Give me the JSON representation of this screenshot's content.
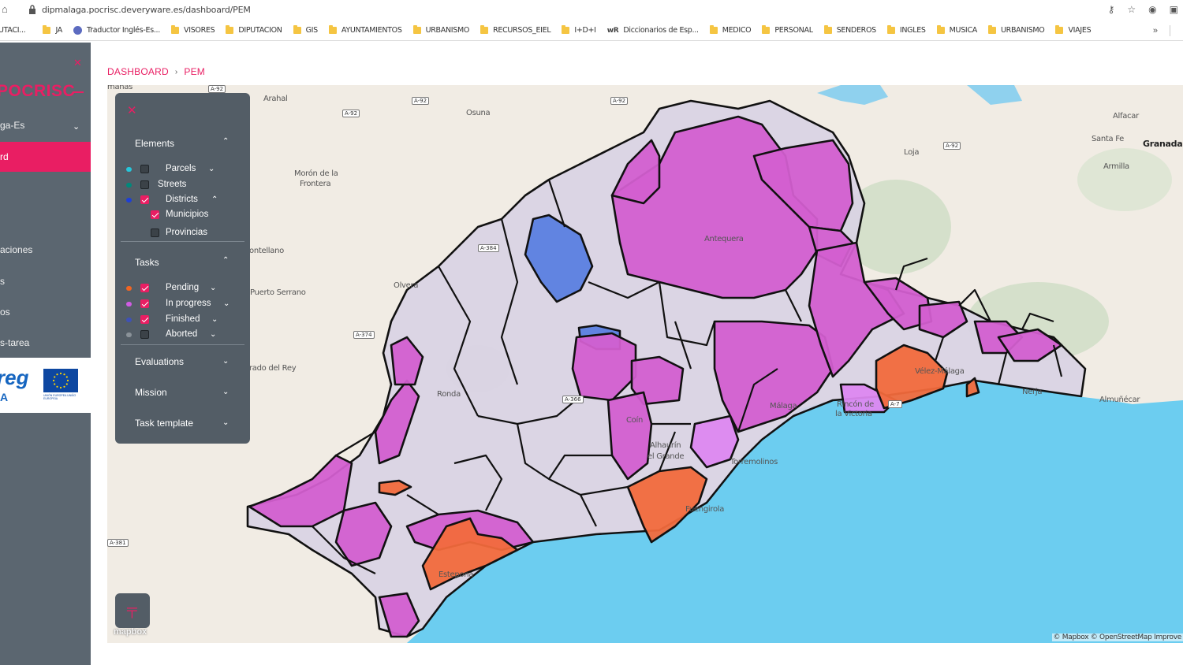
{
  "browser": {
    "url": "dipmalaga.pocrisc.deveryware.es/dashboard/PEM",
    "bookmarks": [
      {
        "label": "UTACI...",
        "icon": "none"
      },
      {
        "label": "JA",
        "icon": "folder"
      },
      {
        "label": "Traductor Inglés-Es...",
        "icon": "globe"
      },
      {
        "label": "VISORES",
        "icon": "folder"
      },
      {
        "label": "DIPUTACION",
        "icon": "folder"
      },
      {
        "label": "GIS",
        "icon": "folder"
      },
      {
        "label": "AYUNTAMIENTOS",
        "icon": "folder"
      },
      {
        "label": "URBANISMO",
        "icon": "folder"
      },
      {
        "label": "RECURSOS_EIEL",
        "icon": "folder"
      },
      {
        "label": "I+D+I",
        "icon": "folder"
      },
      {
        "label": "Diccionarios de Esp...",
        "icon": "wr"
      },
      {
        "label": "MEDICO",
        "icon": "folder"
      },
      {
        "label": "PERSONAL",
        "icon": "folder"
      },
      {
        "label": "SENDEROS",
        "icon": "folder"
      },
      {
        "label": "INGLES",
        "icon": "folder"
      },
      {
        "label": "MUSICA",
        "icon": "folder"
      },
      {
        "label": "URBANISMO",
        "icon": "folder"
      },
      {
        "label": "VIAJES",
        "icon": "folder"
      }
    ],
    "more": "»"
  },
  "sidebar": {
    "brand": "POCRISC",
    "items": [
      {
        "label": "ga-Es"
      },
      {
        "label": "rd"
      },
      {
        "label": "aciones"
      },
      {
        "label": "s"
      },
      {
        "label": "os"
      },
      {
        "label": "s-tarea"
      }
    ],
    "logo_text": "reg",
    "logo_sub": "A",
    "eu_caption": "UNIÓN EUROPEA UNIÃO EUROPEIA"
  },
  "breadcrumb": {
    "root": "DASHBOARD",
    "current": "PEM"
  },
  "legend": {
    "elements_title": "Elements",
    "elements": [
      {
        "label": "Parcels",
        "checked": false,
        "color": "#26c6da",
        "chevron": "down"
      },
      {
        "label": "Streets",
        "checked": false,
        "color": "#00897b",
        "chevron": ""
      },
      {
        "label": "Districts",
        "checked": true,
        "color": "#1e3fd6",
        "chevron": "up"
      }
    ],
    "districts_sub": [
      {
        "label": "Municipios",
        "checked": true
      },
      {
        "label": "Provincias",
        "checked": false
      }
    ],
    "tasks_title": "Tasks",
    "tasks": [
      {
        "label": "Pending",
        "checked": true,
        "color": "#f26522"
      },
      {
        "label": "In progress",
        "checked": true,
        "color": "#d05ce3"
      },
      {
        "label": "Finished",
        "checked": true,
        "color": "#3f51b5"
      },
      {
        "label": "Aborted",
        "checked": false,
        "color": "#8a9299"
      }
    ],
    "evaluations_title": "Evaluations",
    "mission_title": "Mission",
    "task_template_title": "Task template"
  },
  "map": {
    "places": [
      {
        "name": "manas"
      },
      {
        "name": "Arahal"
      },
      {
        "name": "Osuna"
      },
      {
        "name": "Morón de la"
      },
      {
        "name": "Frontera"
      },
      {
        "name": "ontellano"
      },
      {
        "name": "Puerto Serrano"
      },
      {
        "name": "Olvera"
      },
      {
        "name": "rado del Rey"
      },
      {
        "name": "Ronda"
      },
      {
        "name": "Antequera"
      },
      {
        "name": "Loja"
      },
      {
        "name": "Santa Fe"
      },
      {
        "name": "Granada"
      },
      {
        "name": "Armilla"
      },
      {
        "name": "Alfacar"
      },
      {
        "name": "Vélez-Málaga"
      },
      {
        "name": "Rincón de"
      },
      {
        "name": "la Victoria"
      },
      {
        "name": "Málaga"
      },
      {
        "name": "Alhaurín"
      },
      {
        "name": "el Grande"
      },
      {
        "name": "Torremolinos"
      },
      {
        "name": "Fuengirola"
      },
      {
        "name": "Estepona"
      },
      {
        "name": "Almuñécar"
      },
      {
        "name": "Nerja"
      },
      {
        "name": "Coín"
      }
    ],
    "roads": [
      "A-92",
      "A-92",
      "A-92",
      "A-92",
      "A-384",
      "A-374",
      "A-366",
      "A-7",
      "A-381",
      "A-92"
    ],
    "attribution": "© Mapbox © OpenStreetMap Improve",
    "mapbox": "mapbox",
    "colors": {
      "default": "#d9d3e4",
      "in_progress": "#d35fd0",
      "in_progress_light": "#dd88f0",
      "pending": "#f26a3c",
      "finished": "#5b80e0",
      "sea": "#6ccdf0"
    }
  }
}
